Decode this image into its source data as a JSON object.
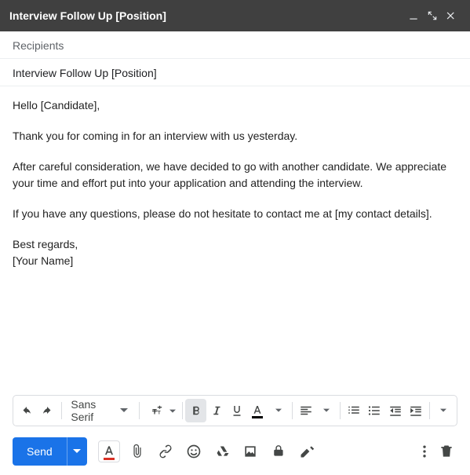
{
  "titlebar": {
    "title": "Interview Follow Up [Position]"
  },
  "fields": {
    "recipients_placeholder": "Recipients",
    "subject": "Interview Follow Up [Position]"
  },
  "body": {
    "p1": "Hello [Candidate],",
    "p2": "Thank you for coming in for an interview with us yesterday.",
    "p3": "After careful consideration, we have decided to go with another candidate. We appreciate your time and effort put into your application and attending the interview.",
    "p4": "If you have any questions, please do not hesitate to contact me at [my contact details].",
    "sig1": "Best regards,",
    "sig2": "[Your Name]"
  },
  "format": {
    "font_family": "Sans Serif"
  },
  "actions": {
    "send_label": "Send"
  }
}
